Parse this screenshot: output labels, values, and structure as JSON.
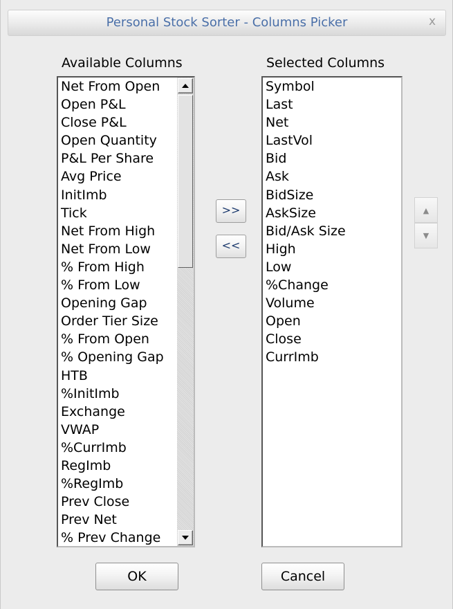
{
  "window": {
    "title": "Personal Stock Sorter - Columns Picker",
    "close_glyph": "x"
  },
  "available": {
    "label": "Available Columns",
    "items": [
      "Net From Open",
      "Open P&L",
      "Close P&L",
      "Open Quantity",
      "P&L Per Share",
      "Avg Price",
      "InitImb",
      "Tick",
      "Net From High",
      "Net From Low",
      "% From High",
      "% From Low",
      "Opening Gap",
      "Order Tier Size",
      "% From Open",
      "% Opening Gap",
      "HTB",
      "%InitImb",
      "Exchange",
      "VWAP",
      "%CurrImb",
      "RegImb",
      "%RegImb",
      "Prev Close",
      "Prev Net",
      "% Prev Change"
    ]
  },
  "selected": {
    "label": "Selected Columns",
    "items": [
      "Symbol",
      "Last",
      "Net",
      "LastVol",
      "Bid",
      "Ask",
      "BidSize",
      "AskSize",
      "Bid/Ask Size",
      "High",
      "Low",
      "%Change",
      "Volume",
      "Open",
      "Close",
      "CurrImb"
    ]
  },
  "buttons": {
    "add": ">>",
    "remove": "<<",
    "ok": "OK",
    "cancel": "Cancel"
  },
  "icons": {
    "move_up": "triangle-up",
    "move_down": "triangle-down",
    "scroll_up": "triangle-up",
    "scroll_down": "triangle-down"
  }
}
